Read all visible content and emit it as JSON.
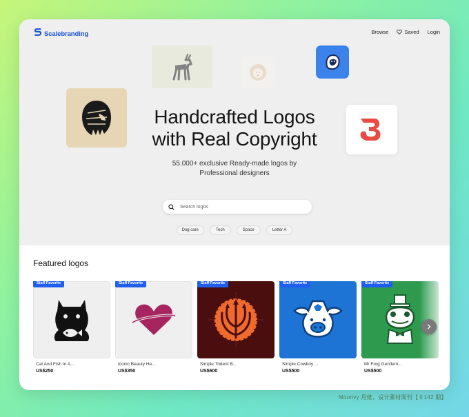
{
  "nav": {
    "brand": "Scalebranding",
    "browse": "Browse",
    "saved": "Saved",
    "login": "Login"
  },
  "hero": {
    "headline_line1": "Handcrafted Logos",
    "headline_line2": "with Real Copyright",
    "sub_line1": "55.000+ exclusive Ready-made logos by",
    "sub_line2": "Professional designers",
    "search_placeholder": "Search logos",
    "chips": [
      "Dog care",
      "Tech",
      "Space",
      "Letter A"
    ]
  },
  "featured": {
    "title": "Featured logos",
    "items": [
      {
        "badge": "Staff Favorite",
        "name": "Cat And Fish In A...",
        "price": "US$250",
        "bg": "#efefef",
        "icon": "cat-fish-logo-icon"
      },
      {
        "badge": "Staff Favorite",
        "name": "Iconic Beauty He...",
        "price": "US$350",
        "bg": "#efefef",
        "icon": "heart-planet-logo-icon"
      },
      {
        "badge": "Staff Favorite",
        "name": "Simple Trident B...",
        "price": "US$600",
        "bg": "#4a0e0e",
        "icon": "trident-ball-logo-icon"
      },
      {
        "badge": "Staff Favorite",
        "name": "Simple Cowboy ...",
        "price": "US$500",
        "bg": "#1d74d4",
        "icon": "cowboy-pig-logo-icon"
      },
      {
        "badge": "Staff Favorite",
        "name": "Mr Frog Gentlem...",
        "price": "US$500",
        "bg": "#2d9a4e",
        "icon": "frog-gentleman-logo-icon"
      }
    ]
  },
  "colors": {
    "brand_blue": "#1f52d8",
    "badge_blue": "#1f5ef0"
  },
  "watermark": "Moonvy 月维，设计素材周刊【＃142 期】"
}
